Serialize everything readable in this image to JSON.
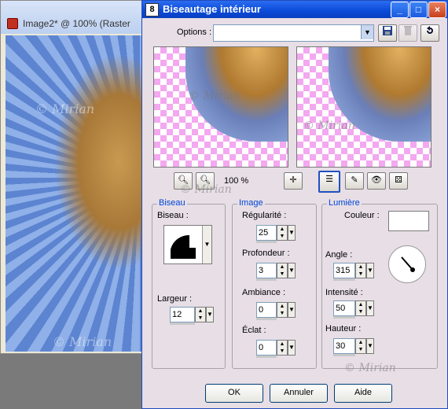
{
  "bg_window": {
    "title": "Image2* @ 100% (Raster",
    "watermark": "© Mirian"
  },
  "dialog": {
    "icon": "8",
    "title": "Biseautage intérieur",
    "title_buttons": {
      "minimize": "_",
      "maximize": "□",
      "close": "×"
    },
    "options_label": "Options :",
    "options_value": "",
    "zoom_label": "100 %",
    "watermark": "© Mirian",
    "biseau": {
      "legend": "Biseau",
      "biseau_label": "Biseau :",
      "largeur_label": "Largeur :",
      "largeur_value": "12"
    },
    "image": {
      "legend": "Image",
      "regularite_label": "Régularité :",
      "regularite_value": "25",
      "profondeur_label": "Profondeur :",
      "profondeur_value": "3",
      "ambiance_label": "Ambiance :",
      "ambiance_value": "0",
      "eclat_label": "Éclat :",
      "eclat_value": "0"
    },
    "lumiere": {
      "legend": "Lumière",
      "couleur_label": "Couleur :",
      "angle_label": "Angle :",
      "angle_value": "315",
      "intensite_label": "Intensité :",
      "intensite_value": "50",
      "hauteur_label": "Hauteur :",
      "hauteur_value": "30"
    },
    "buttons": {
      "ok": "OK",
      "cancel": "Annuler",
      "help": "Aide"
    }
  }
}
